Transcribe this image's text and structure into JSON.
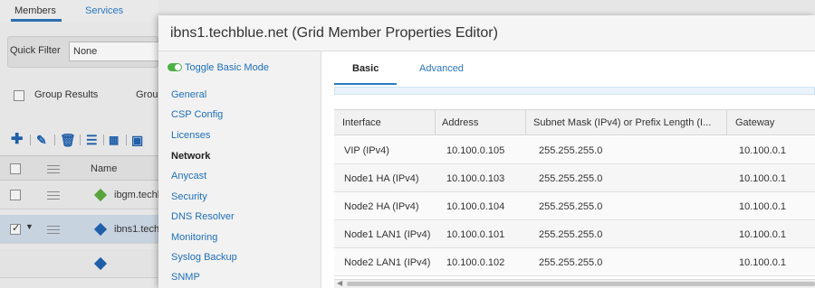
{
  "background": {
    "tabs": [
      "Members",
      "Services"
    ],
    "quick_filter": {
      "label": "Quick Filter",
      "value": "None"
    },
    "group_results_label": "Group Results",
    "group_by_label_partial": "Grou",
    "grid_header_name": "Name",
    "rows": [
      {
        "name": "ibgm.techb",
        "checked": false,
        "icon_color": "#5aa43c"
      },
      {
        "name": "ibns1.tech",
        "checked": true,
        "icon_color": "#1f5fa8"
      },
      {
        "name": "",
        "checked": false,
        "icon_color": "#1f5fa8"
      }
    ]
  },
  "dialog": {
    "title": "ibns1.techblue.net (Grid Member Properties Editor)",
    "toggle_label": "Toggle Basic Mode",
    "nav_items": [
      {
        "label": "General",
        "active": false
      },
      {
        "label": "CSP Config",
        "active": false
      },
      {
        "label": "Licenses",
        "active": false
      },
      {
        "label": "Network",
        "active": true
      },
      {
        "label": "Anycast",
        "active": false
      },
      {
        "label": "Security",
        "active": false
      },
      {
        "label": "DNS Resolver",
        "active": false
      },
      {
        "label": "Monitoring",
        "active": false
      },
      {
        "label": "Syslog Backup",
        "active": false
      },
      {
        "label": "SNMP",
        "active": false
      }
    ],
    "tabs": [
      {
        "label": "Basic",
        "active": true
      },
      {
        "label": "Advanced",
        "active": false
      }
    ],
    "table": {
      "columns": [
        "Interface",
        "Address",
        "Subnet Mask (IPv4) or Prefix Length (I...",
        "Gateway"
      ],
      "rows": [
        [
          "VIP (IPv4)",
          "10.100.0.105",
          "255.255.255.0",
          "10.100.0.1"
        ],
        [
          "Node1 HA (IPv4)",
          "10.100.0.103",
          "255.255.255.0",
          "10.100.0.1"
        ],
        [
          "Node2 HA (IPv4)",
          "10.100.0.104",
          "255.255.255.0",
          "10.100.0.1"
        ],
        [
          "Node1 LAN1 (IPv4)",
          "10.100.0.101",
          "255.255.255.0",
          "10.100.0.1"
        ],
        [
          "Node2 LAN1 (IPv4)",
          "10.100.0.102",
          "255.255.255.0",
          "10.100.0.1"
        ]
      ]
    }
  },
  "colors": {
    "accent": "#2c7cc4",
    "link": "#1f6fba",
    "toggle_on": "#4ab244"
  }
}
